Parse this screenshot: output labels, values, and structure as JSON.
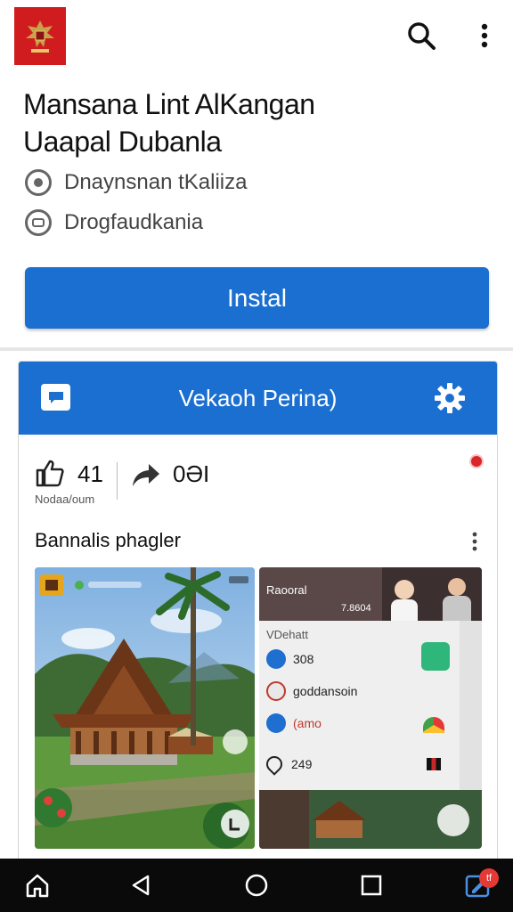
{
  "appbar": {
    "search_icon": "search-icon",
    "more_icon": "more-vert-icon"
  },
  "app": {
    "title_line1": "Mansana Lint AlKangan",
    "title_line2": "Uaapal Dubanla",
    "developer": "Dnaynsnan tKaliiza",
    "category": "Drogfaudkania",
    "install_label": "Instal"
  },
  "card": {
    "title": "Vekaoh Perina)",
    "likes": "41",
    "likes_sub": "Nodaa/oum",
    "shares": "0ƏI",
    "section_title": "Bannalis phagler",
    "screenshot2": {
      "header": "Raooral",
      "header_num": "7.8604",
      "subheader": "VDehatt",
      "rows": [
        {
          "label": "308"
        },
        {
          "label": "goddansoin"
        },
        {
          "label": "(amo"
        }
      ],
      "count": "249"
    }
  },
  "nav": {
    "badge": "tf"
  },
  "colors": {
    "brand_blue": "#1a6fd0",
    "logo_red": "#d01c1f",
    "nav_bg": "#0a0a0a"
  }
}
